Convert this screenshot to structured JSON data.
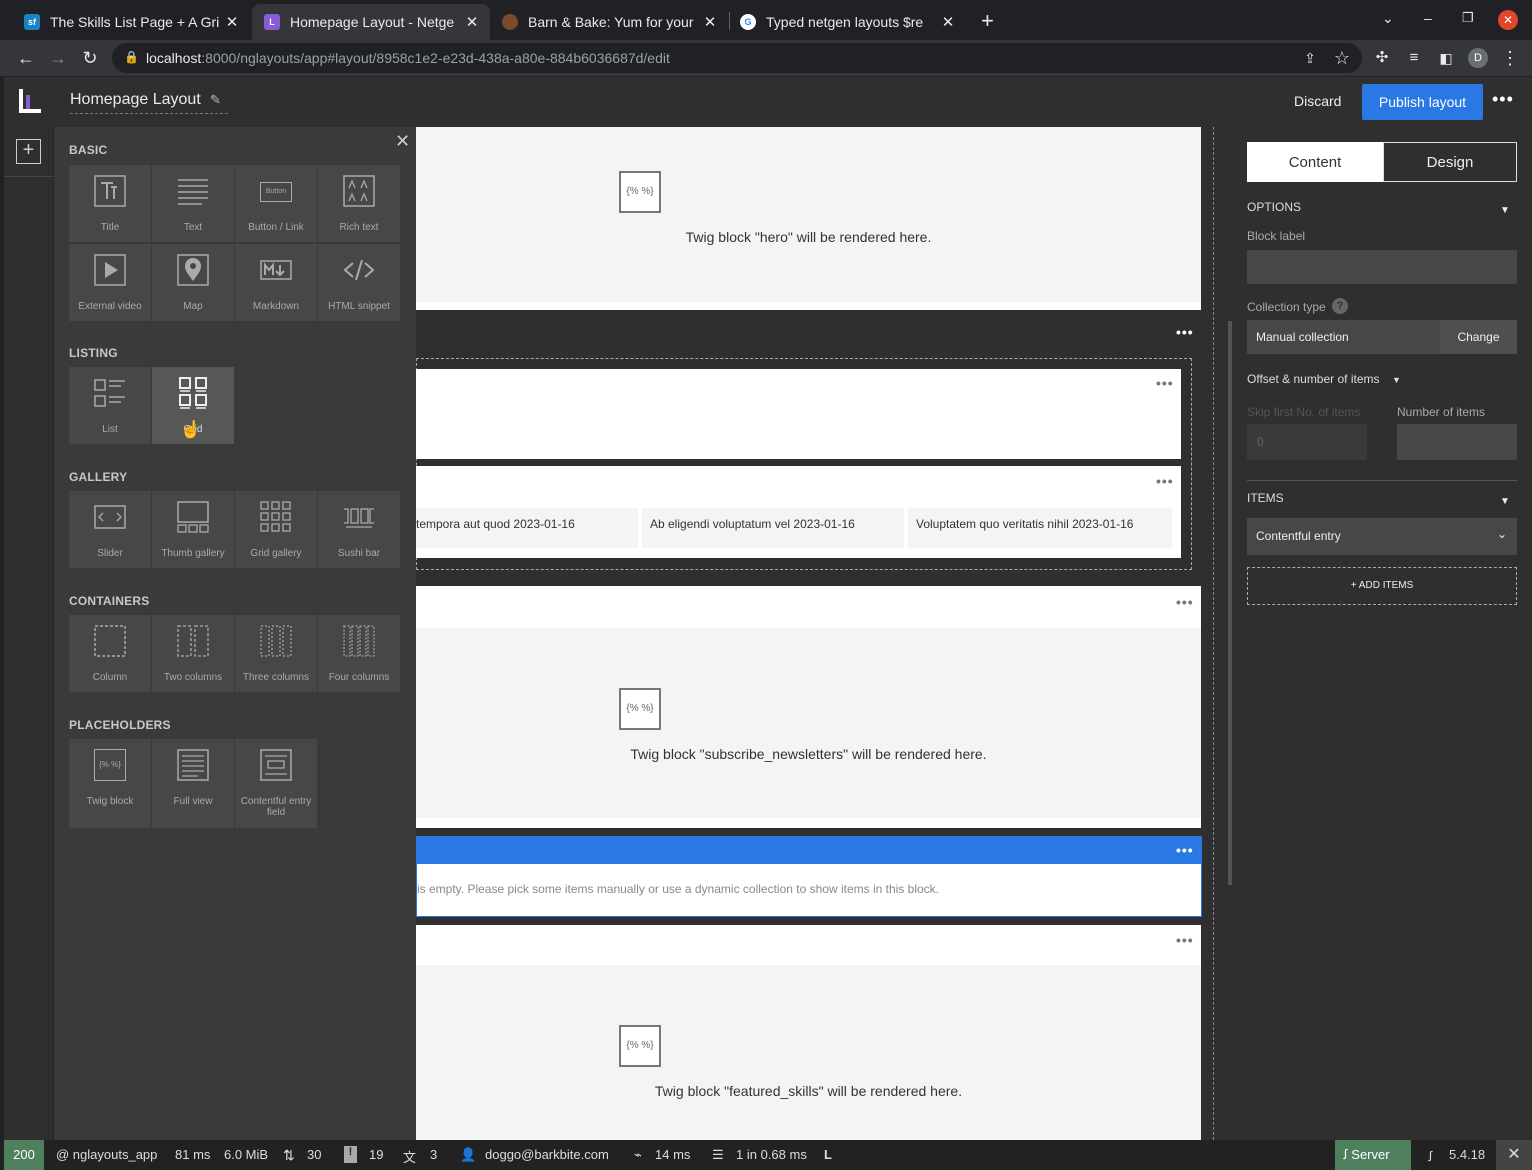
{
  "browser": {
    "tabs": [
      {
        "title": "The Skills List Page + A Gri",
        "active": false
      },
      {
        "title": "Homepage Layout - Netge",
        "active": true
      },
      {
        "title": "Barn & Bake: Yum for your",
        "active": false
      },
      {
        "title": "Typed netgen layouts $re",
        "active": false
      }
    ],
    "url_host": "localhost",
    "url_rest": ":8000/nglayouts/app#layout/8958c1e2-e23d-438a-a80e-884b6036687d/edit",
    "profile_initial": "D"
  },
  "header": {
    "title": "Homepage Layout",
    "discard_label": "Discard",
    "publish_label": "Publish layout"
  },
  "panel": {
    "sections": {
      "basic": {
        "label": "BASIC",
        "items": [
          "Title",
          "Text",
          "Button / Link",
          "Rich text",
          "External video",
          "Map",
          "Markdown",
          "HTML snippet"
        ]
      },
      "listing": {
        "label": "LISTING",
        "items": [
          "List",
          "Grid"
        ]
      },
      "gallery": {
        "label": "GALLERY",
        "items": [
          "Slider",
          "Thumb gallery",
          "Grid gallery",
          "Sushi bar"
        ]
      },
      "containers": {
        "label": "CONTAINERS",
        "items": [
          "Column",
          "Two columns",
          "Three columns",
          "Four columns"
        ]
      },
      "placeholders": {
        "label": "PLACEHOLDERS",
        "items": [
          "Twig block",
          "Full view",
          "Contentful entry field"
        ]
      }
    },
    "icon_text": {
      "button": "Button",
      "twig": "{% %}"
    }
  },
  "canvas": {
    "hero_text": "Twig block \"hero\" will be rendered here.",
    "grid_items": [
      "tempora aut quod 2023-01-16",
      "Ab eligendi voluptatum vel 2023-01-16",
      "Voluptatem quo veritatis nihil 2023-01-16"
    ],
    "newsletter_text": "Twig block \"subscribe_newsletters\" will be rendered here.",
    "empty_text": "is empty. Please pick some items manually or use a dynamic collection to show items in this block.",
    "featured_text": "Twig block \"featured_skills\" will be rendered here."
  },
  "sidebar": {
    "tab_content": "Content",
    "tab_design": "Design",
    "options_label": "OPTIONS",
    "block_label": "Block label",
    "collection_type_label": "Collection type",
    "collection_type_value": "Manual collection",
    "change_label": "Change",
    "offset_label": "Offset & number of items",
    "skip_label": "Skip first No. of items",
    "skip_value": "0",
    "number_label": "Number of items",
    "items_label": "ITEMS",
    "item_type": "Contentful entry",
    "add_items_label": "+ ADD ITEMS"
  },
  "statusbar": {
    "code": "200",
    "route": "@ nglayouts_app",
    "time": "81 ms",
    "memory": "6.0 MiB",
    "forms": "30",
    "warnings": "19",
    "translations": "3",
    "user": "doggo@barkbite.com",
    "events_time": "14 ms",
    "db": "1 in 0.68 ms",
    "server_label": "Server",
    "version": "5.4.18"
  },
  "colors": {
    "accent": "#2a78e4",
    "panel": "#3a3a3a",
    "canvas": "#2f2f2f"
  }
}
